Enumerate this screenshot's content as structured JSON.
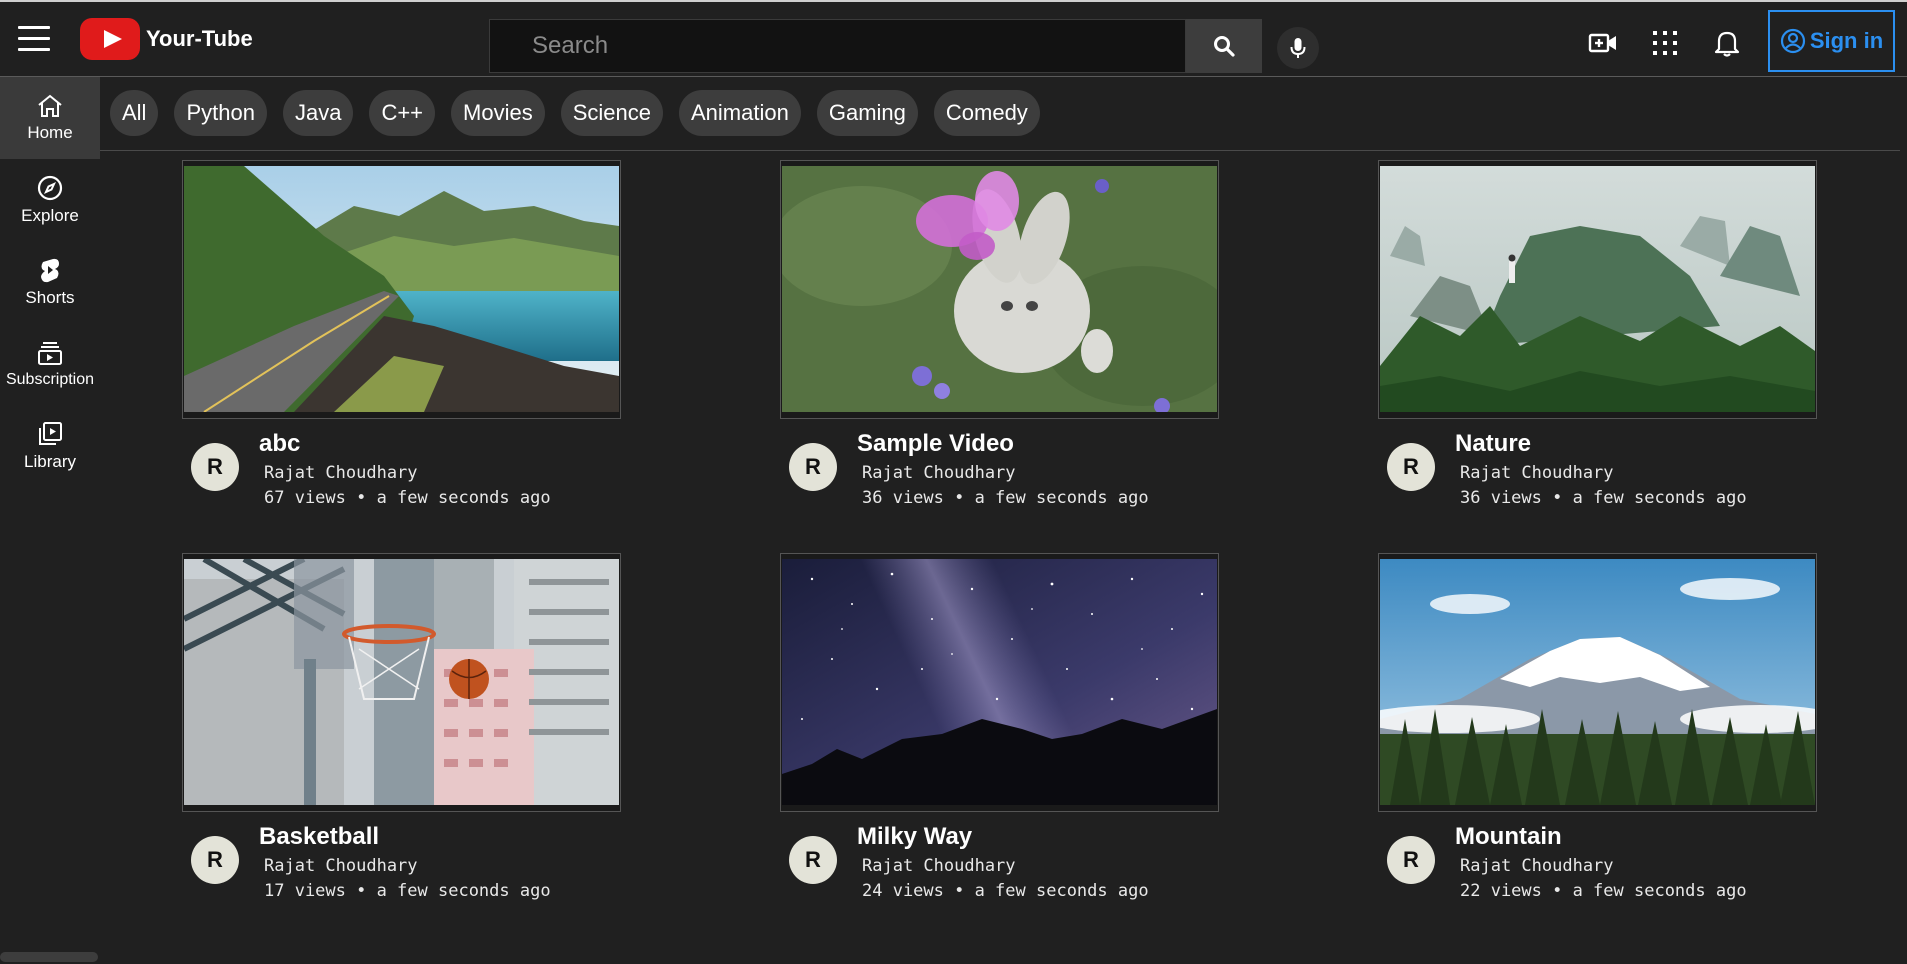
{
  "header": {
    "app_name": "Your-Tube",
    "search_placeholder": "Search",
    "signin_label": "Sign in"
  },
  "icons": {
    "menu": "hamburger-icon",
    "logo": "play-logo-icon",
    "search": "search-icon",
    "mic": "mic-icon",
    "create": "video-plus-icon",
    "apps": "apps-grid-icon",
    "notifications": "bell-icon",
    "account": "account-circle-icon"
  },
  "colors": {
    "background": "#202020",
    "brand_red": "#e01b1b",
    "signin_blue": "#2b8ff0",
    "chip_bg": "#3d3d3d",
    "avatar_bg": "#e3e3d8"
  },
  "sidebar": {
    "items": [
      {
        "label": "Home",
        "icon": "home-icon",
        "active": true
      },
      {
        "label": "Explore",
        "icon": "compass-icon",
        "active": false
      },
      {
        "label": "Shorts",
        "icon": "shorts-icon",
        "active": false
      },
      {
        "label": "Subscription",
        "icon": "subscriptions-icon",
        "active": false
      },
      {
        "label": "Library",
        "icon": "library-icon",
        "active": false
      }
    ]
  },
  "chips": [
    "All",
    "Python",
    "Java",
    "C++",
    "Movies",
    "Science",
    "Animation",
    "Gaming",
    "Comedy"
  ],
  "videos": [
    {
      "title": "abc",
      "channel": "Rajat Choudhary",
      "avatar": "R",
      "meta": "67 views  • a few seconds ago",
      "thumb": "coastal-road"
    },
    {
      "title": "Sample Video",
      "channel": "Rajat Choudhary",
      "avatar": "R",
      "meta": "36 views  • a few seconds ago",
      "thumb": "bunny-butterfly"
    },
    {
      "title": "Nature",
      "channel": "Rajat Choudhary",
      "avatar": "R",
      "meta": "36 views  • a few seconds ago",
      "thumb": "misty-islands"
    },
    {
      "title": "Basketball",
      "channel": "Rajat Choudhary",
      "avatar": "R",
      "meta": "17 views  • a few seconds ago",
      "thumb": "basketball-hoop"
    },
    {
      "title": "Milky Way",
      "channel": "Rajat Choudhary",
      "avatar": "R",
      "meta": "24 views  • a few seconds ago",
      "thumb": "night-sky"
    },
    {
      "title": "Mountain",
      "channel": "Rajat Choudhary",
      "avatar": "R",
      "meta": "22 views  • a few seconds ago",
      "thumb": "snowy-mountain"
    }
  ]
}
